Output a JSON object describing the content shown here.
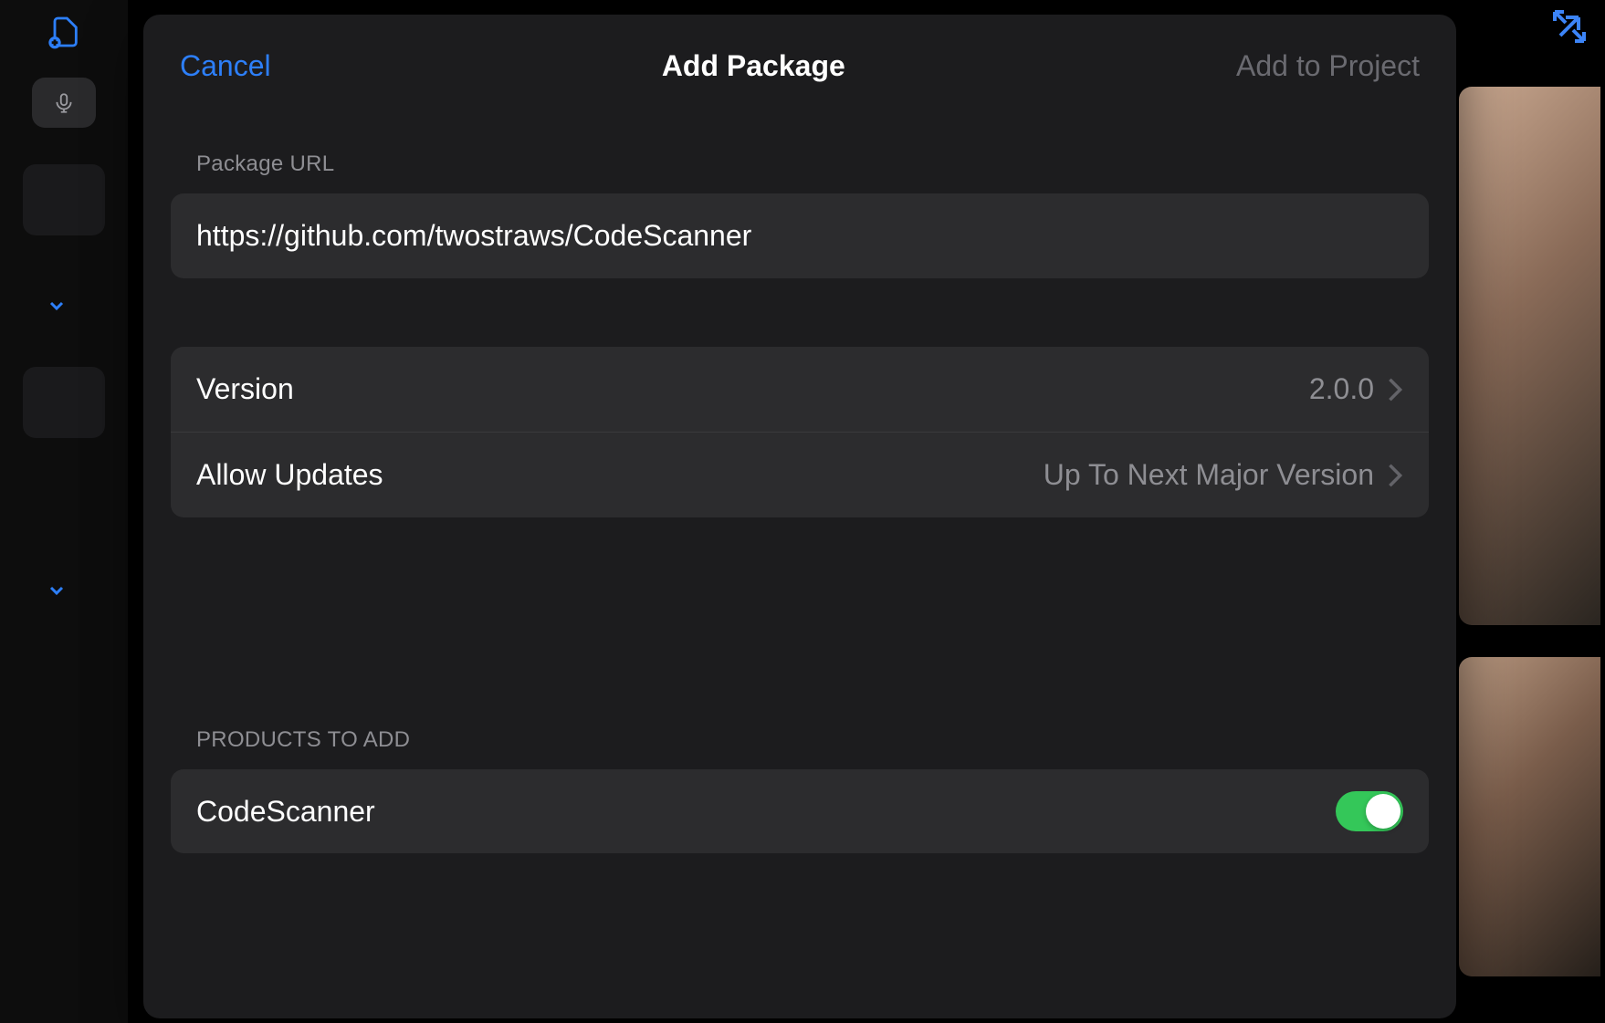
{
  "modal": {
    "cancel_label": "Cancel",
    "title": "Add Package",
    "add_to_project_label": "Add to Project"
  },
  "package_url": {
    "section_label": "Package URL",
    "value": "https://github.com/twostraws/CodeScanner"
  },
  "settings": {
    "version": {
      "label": "Version",
      "value": "2.0.0"
    },
    "allow_updates": {
      "label": "Allow Updates",
      "value": "Up To Next Major Version"
    }
  },
  "products": {
    "section_label": "Products to Add",
    "items": [
      {
        "name": "CodeScanner",
        "enabled": true
      }
    ]
  }
}
